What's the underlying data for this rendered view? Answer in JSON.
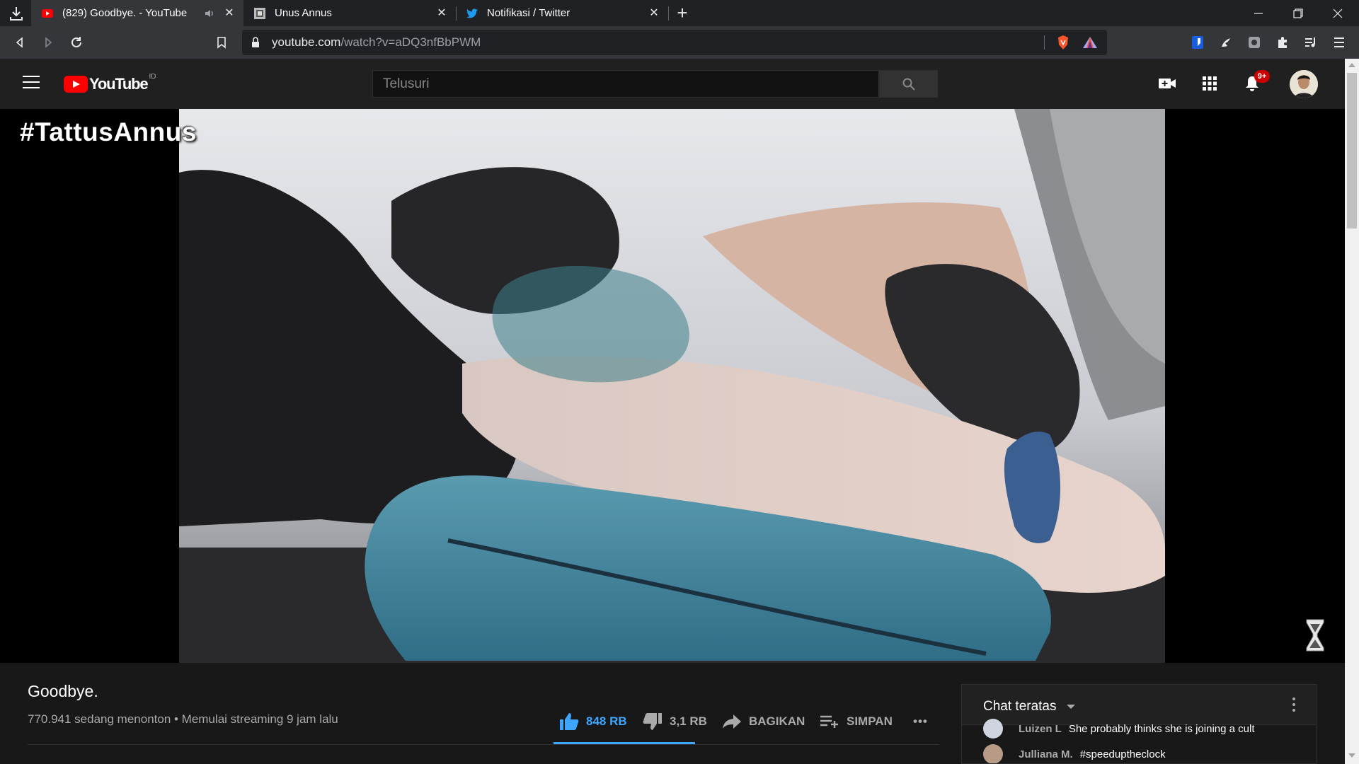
{
  "browser": {
    "tabs": [
      {
        "title": "(829) Goodbye. - YouTube",
        "favicon": "youtube-icon",
        "active": true,
        "audio": true
      },
      {
        "title": "Unus Annus",
        "favicon": "unus-annus-icon",
        "active": false
      },
      {
        "title": "Notifikasi / Twitter",
        "favicon": "twitter-icon",
        "active": false
      }
    ],
    "new_tab_symbol": "+",
    "url_host": "youtube.com",
    "url_path": "/watch?v=aDQ3nfBbPWM"
  },
  "youtube": {
    "logo_text": "YouTube",
    "country_code": "ID",
    "search_placeholder": "Telusuri",
    "notification_badge": "9+"
  },
  "video": {
    "overlay_hashtag": "#TattusAnnus",
    "title": "Goodbye.",
    "meta": "770.941 sedang menonton • Memulai streaming 9 jam lalu",
    "like_count": "848 RB",
    "dislike_count": "3,1 RB",
    "share_label": "BAGIKAN",
    "save_label": "SIMPAN",
    "more_label": "•••"
  },
  "chat": {
    "header": "Chat teratas",
    "messages": [
      {
        "author": "Luizen L",
        "text": "She probably thinks she is joining a cult"
      },
      {
        "author": "Julliana M.",
        "text": "#speeduptheclock"
      }
    ]
  },
  "colors": {
    "youtube_red": "#ff0000",
    "like_blue": "#3ea6ff",
    "twitter_blue": "#1d9bf0",
    "brave_orange": "#fb542b"
  }
}
